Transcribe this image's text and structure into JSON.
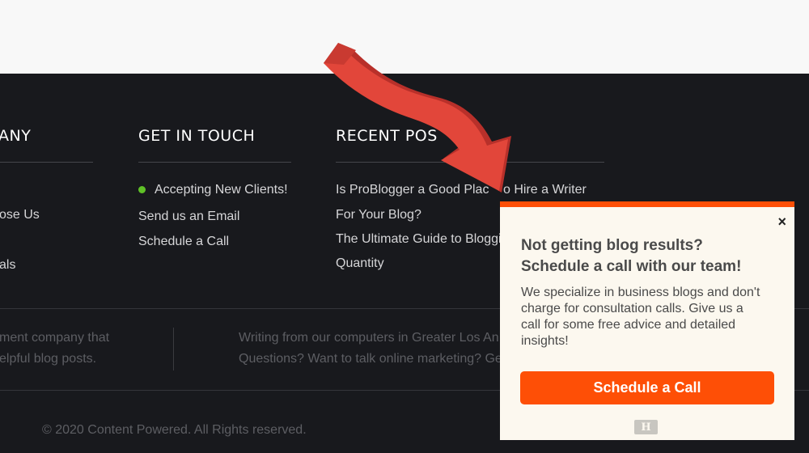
{
  "footer": {
    "company": {
      "heading": "ANY",
      "items": [
        "ose Us",
        "als"
      ]
    },
    "get_in_touch": {
      "heading": "GET IN TOUCH",
      "status": "Accepting New Clients!",
      "status_color": "#5fc127",
      "items": [
        "Send us an Email",
        "Schedule a Call"
      ]
    },
    "recent_posts": {
      "heading": "RECENT POS",
      "posts": [
        {
          "line1": "Is ProBlogger a Good Plac",
          "line1_end": "o Hire a Writer",
          "line2": "For Your Blog?"
        },
        {
          "line1": "The Ultimate Guide to Bloggi",
          "line2": "Quantity"
        }
      ]
    },
    "about": [
      "ment company that",
      "elpful blog posts."
    ],
    "location": [
      "Writing from our computers in Greater Los An",
      "Questions? Want to talk online marketing? Ge"
    ],
    "copyright": "© 2020 Content Powered. All Rights reserved."
  },
  "popup": {
    "title_line1": "Not getting blog results?",
    "title_line2": "Schedule a call with our team!",
    "body": "We specialize in business blogs and don't charge for consultation calls. Give us a call for some free advice and detailed insights!",
    "button": "Schedule a Call",
    "close": "×",
    "logo": "H",
    "accent": "#fe4f06"
  }
}
